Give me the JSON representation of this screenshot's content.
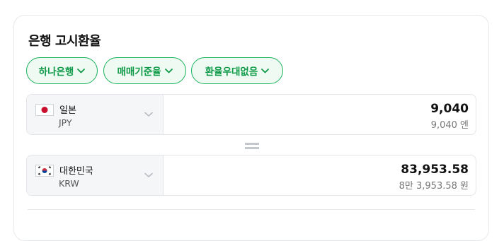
{
  "title": "은행 고시환율",
  "filters": [
    {
      "label": "하나은행"
    },
    {
      "label": "매매기준율"
    },
    {
      "label": "환율우대없음"
    }
  ],
  "from": {
    "country": "일본",
    "code": "JPY",
    "amount": "9,040",
    "amount_sub": "9,040 엔",
    "flag_icon": "japan-flag-icon"
  },
  "to": {
    "country": "대한민국",
    "code": "KRW",
    "amount": "83,953.58",
    "amount_sub": "8만 3,953.58 원",
    "flag_icon": "korea-flag-icon"
  },
  "colors": {
    "accent": "#0e9a47",
    "chip_bg": "#eefaf2",
    "chip_border": "#1bb35a"
  }
}
